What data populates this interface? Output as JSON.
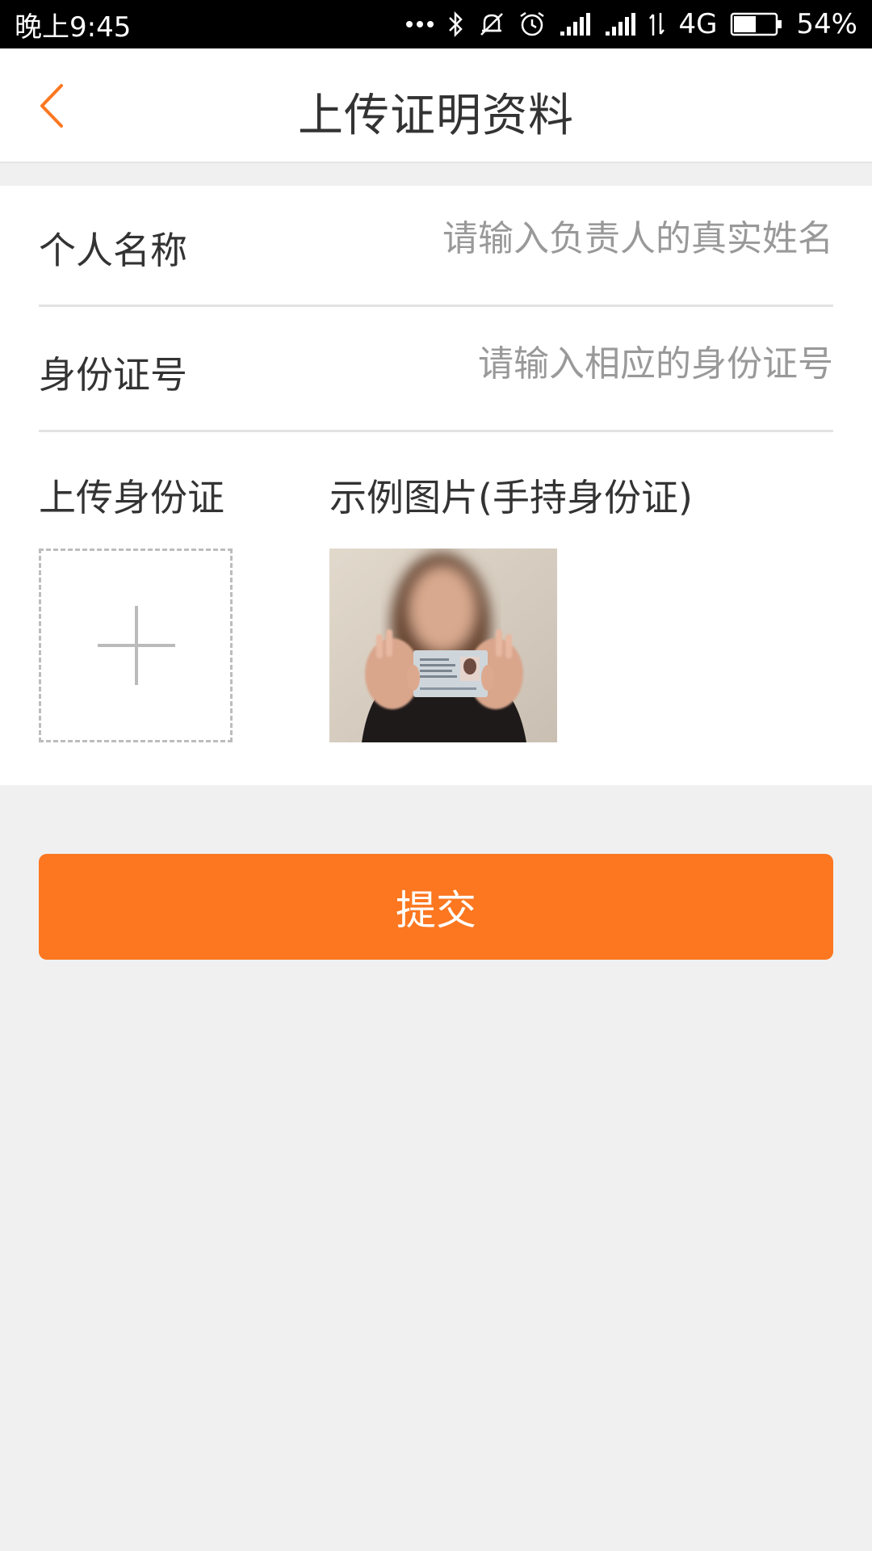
{
  "status_bar": {
    "time": "晚上9:45",
    "network": "4G",
    "battery": "54%",
    "battery_level": 0.54,
    "icons": [
      "more-dots-icon",
      "bluetooth-icon",
      "silent-icon",
      "alarm-icon",
      "signal-icon",
      "signal-icon",
      "data-transfer-icon",
      "battery-icon"
    ]
  },
  "nav": {
    "title": "上传证明资料",
    "back_icon": "chevron-left-icon",
    "accent_color": "#fc7720"
  },
  "form": {
    "name_label": "个人名称",
    "name_placeholder": "请输入负责人的真实姓名",
    "name_value": "",
    "id_label": "身份证号",
    "id_placeholder": "请输入相应的身份证号",
    "id_value": "",
    "upload_label": "上传身份证",
    "upload_icon": "plus-icon",
    "example_label": "示例图片(手持身份证)"
  },
  "submit": {
    "label": "提交",
    "color": "#fc7720"
  }
}
